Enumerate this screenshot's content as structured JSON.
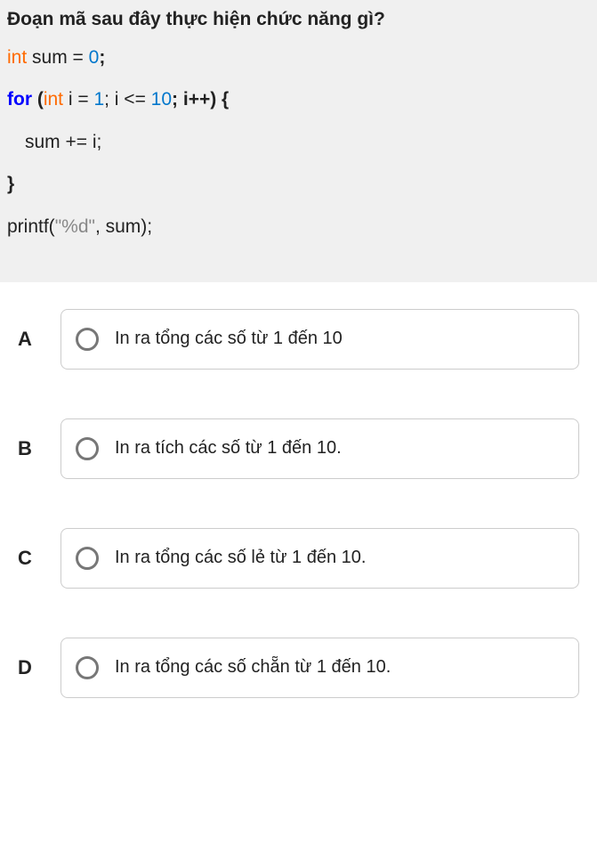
{
  "question": {
    "title": "Đoạn mã sau đây thực hiện chức năng gì?",
    "code": {
      "l1_t1": "int",
      "l1_t2": " sum = ",
      "l1_t3": "0",
      "l1_t4": ";",
      "l2_t1": "for",
      "l2_t2": " (",
      "l2_t3": "int",
      "l2_t4": " i = ",
      "l2_t5": "1",
      "l2_t6": "; i <= ",
      "l2_t7": "10",
      "l2_t8": "; i++) {",
      "l3_t1": "sum += i;",
      "l4_t1": "}",
      "l5_t1": "printf(",
      "l5_t2": "\"%d\"",
      "l5_t3": ", sum);"
    }
  },
  "options": [
    {
      "letter": "A",
      "text": "In ra tổng các số từ 1 đến 10"
    },
    {
      "letter": "B",
      "text": "In ra tích các số từ 1 đến 10."
    },
    {
      "letter": "C",
      "text": "In ra tổng các số lẻ từ 1 đến 10."
    },
    {
      "letter": "D",
      "text": "In ra tổng các số chẵn từ 1 đến 10."
    }
  ]
}
